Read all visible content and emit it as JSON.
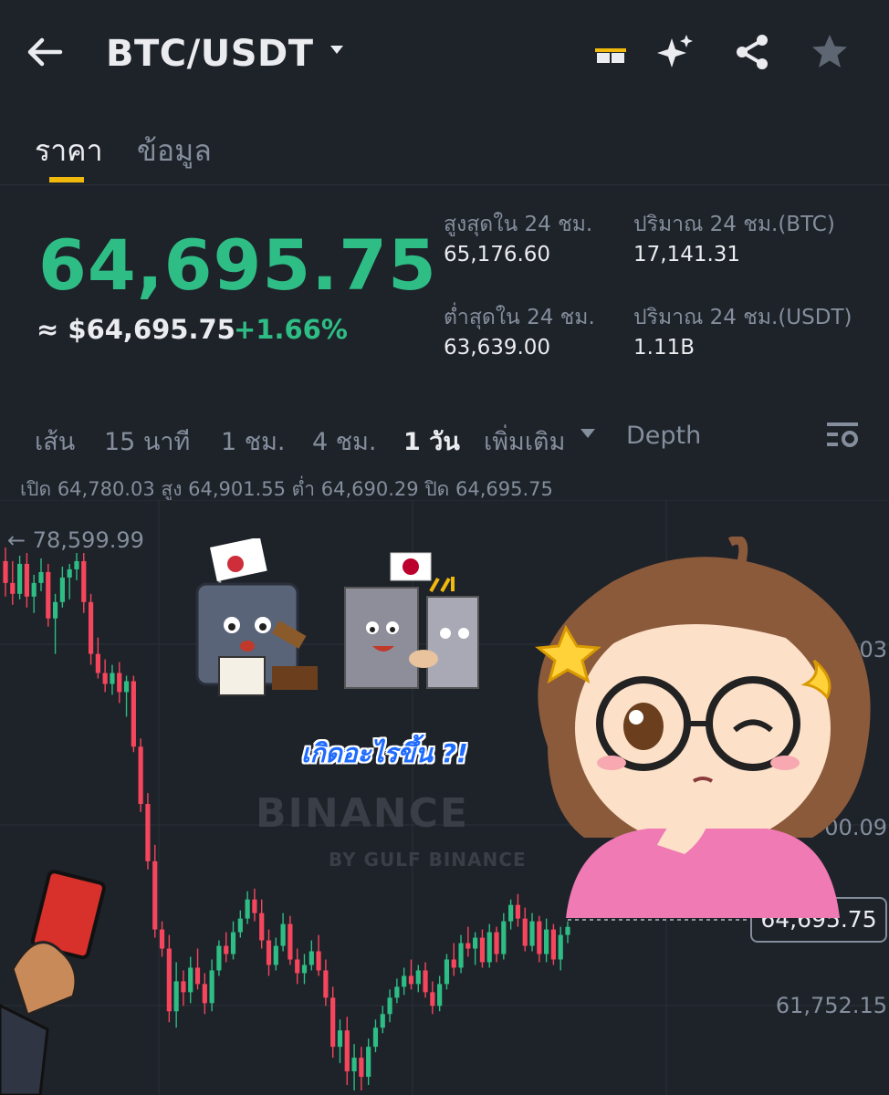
{
  "header": {
    "pair": "BTC/USDT",
    "icons": [
      "back-arrow-icon",
      "pair-dropdown-icon",
      "gift-icon",
      "sparkle-ai-icon",
      "share-icon",
      "star-icon"
    ]
  },
  "tabs": [
    {
      "label": "ราคา",
      "active": true
    },
    {
      "label": "ข้อมูล",
      "active": false
    }
  ],
  "price": {
    "last": "64,695.75",
    "approx": "≈ $64,695.75",
    "change": "+1.66%"
  },
  "stats": {
    "high_label": "สูงสุดใน 24 ชม.",
    "high_value": "65,176.60",
    "vol_btc_label": "ปริมาณ 24 ชม.(BTC)",
    "vol_btc_value": "17,141.31",
    "low_label": "ต่ำสุดใน 24 ชม.",
    "low_value": "63,639.00",
    "vol_usdt_label": "ปริมาณ 24 ชม.(USDT)",
    "vol_usdt_value": "1.11B"
  },
  "intervals": [
    {
      "label": "เส้น",
      "active": false
    },
    {
      "label": "15 นาที",
      "active": false
    },
    {
      "label": "1 ชม.",
      "active": false
    },
    {
      "label": "4 ชม.",
      "active": false
    },
    {
      "label": "1 วัน",
      "active": true
    },
    {
      "label": "เพิ่มเติม",
      "active": false
    },
    {
      "label": "Depth",
      "active": false
    }
  ],
  "ohlc": "เปิด 64,780.03 สูง 64,901.55 ต่ำ 64,690.29 ปิด 64,695.75",
  "overlay": {
    "caption": "เกิดอะไรขึ้น ?!",
    "watermark": "BINANCE",
    "watermark_sub": "BY GULF BINANCE"
  },
  "colors": {
    "background": "#1e2229",
    "up": "#2ebd85",
    "down": "#f6465d",
    "accent": "#f0b90b",
    "muted": "#848e9c"
  },
  "chart_data": {
    "type": "candlestick",
    "y_labels": [
      "← 78,599.99",
      "78.03",
      "00.09",
      "61,752.15"
    ],
    "last_price_label": "64,695.75",
    "ylim": [
      58500,
      80000
    ],
    "candles": [
      {
        "o": 78100,
        "h": 78600,
        "l": 76800,
        "c": 77300
      },
      {
        "o": 77300,
        "h": 78100,
        "l": 76500,
        "c": 76900
      },
      {
        "o": 76900,
        "h": 78300,
        "l": 76700,
        "c": 78000
      },
      {
        "o": 78000,
        "h": 78400,
        "l": 76400,
        "c": 76800
      },
      {
        "o": 76800,
        "h": 77600,
        "l": 76200,
        "c": 77300
      },
      {
        "o": 77300,
        "h": 78200,
        "l": 77000,
        "c": 77700
      },
      {
        "o": 77700,
        "h": 78000,
        "l": 75700,
        "c": 76000
      },
      {
        "o": 76000,
        "h": 76900,
        "l": 74700,
        "c": 76600
      },
      {
        "o": 76600,
        "h": 77900,
        "l": 76400,
        "c": 77500
      },
      {
        "o": 77500,
        "h": 78000,
        "l": 76700,
        "c": 77800
      },
      {
        "o": 77800,
        "h": 78400,
        "l": 77400,
        "c": 78100
      },
      {
        "o": 78100,
        "h": 78400,
        "l": 76200,
        "c": 76600
      },
      {
        "o": 76600,
        "h": 76900,
        "l": 74300,
        "c": 74700
      },
      {
        "o": 74700,
        "h": 75300,
        "l": 73800,
        "c": 74000
      },
      {
        "o": 74000,
        "h": 74500,
        "l": 73300,
        "c": 73600
      },
      {
        "o": 73600,
        "h": 74300,
        "l": 73200,
        "c": 74000
      },
      {
        "o": 74000,
        "h": 74400,
        "l": 72900,
        "c": 73300
      },
      {
        "o": 73300,
        "h": 73900,
        "l": 72400,
        "c": 73700
      },
      {
        "o": 73700,
        "h": 73900,
        "l": 71100,
        "c": 71300
      },
      {
        "o": 71300,
        "h": 71600,
        "l": 68900,
        "c": 69200
      },
      {
        "o": 69200,
        "h": 69600,
        "l": 66800,
        "c": 67100
      },
      {
        "o": 67100,
        "h": 67700,
        "l": 64300,
        "c": 64600
      },
      {
        "o": 64600,
        "h": 64900,
        "l": 63600,
        "c": 63900
      },
      {
        "o": 63900,
        "h": 64400,
        "l": 61200,
        "c": 61600
      },
      {
        "o": 61600,
        "h": 63400,
        "l": 61000,
        "c": 62700
      },
      {
        "o": 62700,
        "h": 63100,
        "l": 61800,
        "c": 62300
      },
      {
        "o": 62300,
        "h": 63600,
        "l": 61900,
        "c": 63200
      },
      {
        "o": 63200,
        "h": 63900,
        "l": 62400,
        "c": 62600
      },
      {
        "o": 62600,
        "h": 63000,
        "l": 61500,
        "c": 61900
      },
      {
        "o": 61900,
        "h": 63500,
        "l": 61600,
        "c": 63100
      },
      {
        "o": 63100,
        "h": 64200,
        "l": 62900,
        "c": 64000
      },
      {
        "o": 64000,
        "h": 64500,
        "l": 63400,
        "c": 63700
      },
      {
        "o": 63700,
        "h": 64900,
        "l": 63500,
        "c": 64500
      },
      {
        "o": 64500,
        "h": 65300,
        "l": 64300,
        "c": 65000
      },
      {
        "o": 65000,
        "h": 66000,
        "l": 64800,
        "c": 65700
      },
      {
        "o": 65700,
        "h": 66100,
        "l": 64900,
        "c": 65200
      },
      {
        "o": 65200,
        "h": 65700,
        "l": 63900,
        "c": 64200
      },
      {
        "o": 64200,
        "h": 64600,
        "l": 62900,
        "c": 63300
      },
      {
        "o": 63300,
        "h": 64300,
        "l": 63100,
        "c": 64000
      },
      {
        "o": 64000,
        "h": 65200,
        "l": 63800,
        "c": 64800
      },
      {
        "o": 64800,
        "h": 65100,
        "l": 63300,
        "c": 63500
      },
      {
        "o": 63500,
        "h": 63900,
        "l": 62600,
        "c": 63000
      },
      {
        "o": 63000,
        "h": 63700,
        "l": 62600,
        "c": 63300
      },
      {
        "o": 63300,
        "h": 64200,
        "l": 63100,
        "c": 63800
      },
      {
        "o": 63800,
        "h": 64400,
        "l": 62900,
        "c": 63100
      },
      {
        "o": 63100,
        "h": 63500,
        "l": 61800,
        "c": 62100
      },
      {
        "o": 62100,
        "h": 62500,
        "l": 59900,
        "c": 60300
      },
      {
        "o": 60300,
        "h": 61300,
        "l": 59700,
        "c": 60900
      },
      {
        "o": 60900,
        "h": 61400,
        "l": 58900,
        "c": 59400
      },
      {
        "o": 59400,
        "h": 60400,
        "l": 58700,
        "c": 59900
      },
      {
        "o": 59900,
        "h": 60300,
        "l": 58700,
        "c": 59200
      },
      {
        "o": 59200,
        "h": 60600,
        "l": 58900,
        "c": 60300
      },
      {
        "o": 60300,
        "h": 61300,
        "l": 60100,
        "c": 61000
      },
      {
        "o": 61000,
        "h": 61800,
        "l": 60800,
        "c": 61500
      },
      {
        "o": 61500,
        "h": 62400,
        "l": 61200,
        "c": 62100
      },
      {
        "o": 62100,
        "h": 62800,
        "l": 61900,
        "c": 62500
      },
      {
        "o": 62500,
        "h": 63200,
        "l": 62200,
        "c": 62900
      },
      {
        "o": 62900,
        "h": 63500,
        "l": 62400,
        "c": 62600
      },
      {
        "o": 62600,
        "h": 63300,
        "l": 62300,
        "c": 63100
      },
      {
        "o": 63100,
        "h": 63400,
        "l": 62100,
        "c": 62300
      },
      {
        "o": 62300,
        "h": 62700,
        "l": 61500,
        "c": 61800
      },
      {
        "o": 61800,
        "h": 62900,
        "l": 61600,
        "c": 62600
      },
      {
        "o": 62600,
        "h": 63700,
        "l": 62400,
        "c": 63500
      },
      {
        "o": 63500,
        "h": 64100,
        "l": 62900,
        "c": 63200
      },
      {
        "o": 63200,
        "h": 64400,
        "l": 63000,
        "c": 64100
      },
      {
        "o": 64100,
        "h": 64700,
        "l": 63600,
        "c": 63900
      },
      {
        "o": 63900,
        "h": 64500,
        "l": 63300,
        "c": 64300
      },
      {
        "o": 64300,
        "h": 64600,
        "l": 63200,
        "c": 63400
      },
      {
        "o": 63400,
        "h": 64800,
        "l": 63200,
        "c": 64500
      },
      {
        "o": 64500,
        "h": 64700,
        "l": 63400,
        "c": 63700
      },
      {
        "o": 63700,
        "h": 65200,
        "l": 63500,
        "c": 64900
      },
      {
        "o": 64900,
        "h": 65700,
        "l": 64600,
        "c": 65500
      },
      {
        "o": 65500,
        "h": 65900,
        "l": 64700,
        "c": 65000
      },
      {
        "o": 65000,
        "h": 65400,
        "l": 63800,
        "c": 64000
      },
      {
        "o": 64000,
        "h": 65200,
        "l": 63800,
        "c": 64900
      },
      {
        "o": 64900,
        "h": 65100,
        "l": 63400,
        "c": 63700
      },
      {
        "o": 63700,
        "h": 65000,
        "l": 63400,
        "c": 64600
      },
      {
        "o": 64600,
        "h": 64800,
        "l": 63300,
        "c": 63500
      },
      {
        "o": 63500,
        "h": 64700,
        "l": 63100,
        "c": 64400
      },
      {
        "o": 64400,
        "h": 64900,
        "l": 64100,
        "c": 64696
      }
    ]
  }
}
